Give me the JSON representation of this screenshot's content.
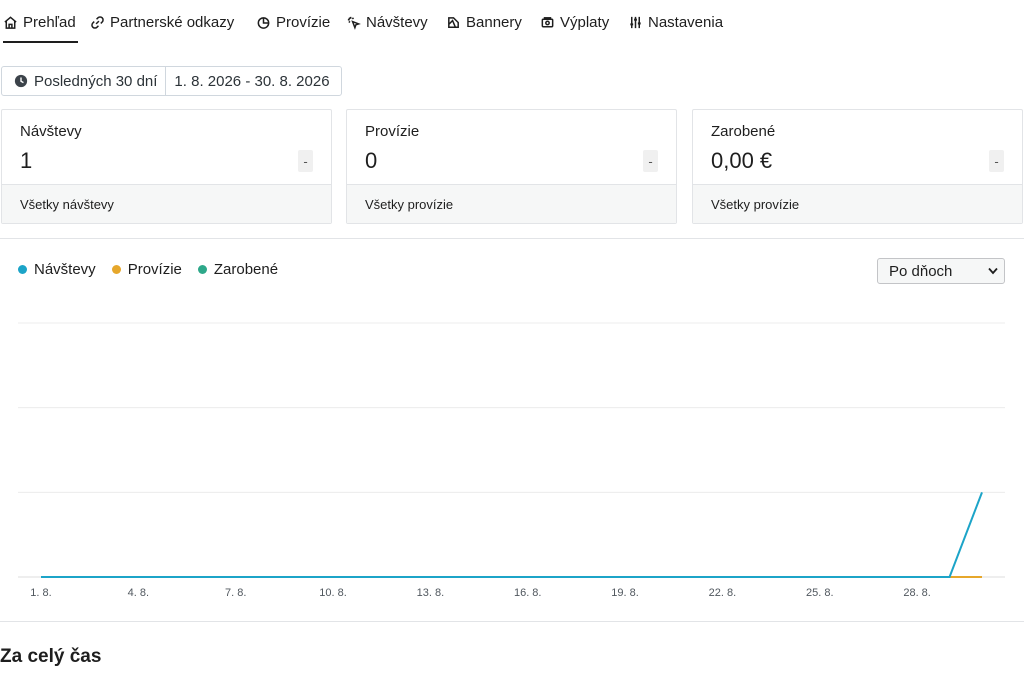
{
  "tabs": [
    {
      "label": "Prehľad",
      "icon": "home-icon",
      "active": true
    },
    {
      "label": "Partnerské odkazy",
      "icon": "link-icon"
    },
    {
      "label": "Provízie",
      "icon": "pie-chart-icon"
    },
    {
      "label": "Návštevy",
      "icon": "cursor-click-icon"
    },
    {
      "label": "Bannery",
      "icon": "banner-icon"
    },
    {
      "label": "Výplaty",
      "icon": "cash-icon"
    },
    {
      "label": "Nastavenia",
      "icon": "sliders-icon"
    }
  ],
  "daterange": {
    "preset": "Posledných 30 dní",
    "range": "1. 8. 2026 - 30. 8. 2026"
  },
  "cards": [
    {
      "title": "Návštevy",
      "value": "1",
      "delta": "-",
      "link": "Všetky návštevy"
    },
    {
      "title": "Provízie",
      "value": "0",
      "delta": "-",
      "link": "Všetky provízie"
    },
    {
      "title": "Zarobené",
      "value": "0,00 €",
      "delta": "-",
      "link": "Všetky provízie"
    }
  ],
  "legend": [
    {
      "label": "Návštevy",
      "color": "#1ca4c8"
    },
    {
      "label": "Provízie",
      "color": "#e6a72b"
    },
    {
      "label": "Zarobené",
      "color": "#2ea88a"
    }
  ],
  "interval_select": {
    "value": "Po dňoch"
  },
  "chart_data": {
    "type": "line",
    "x": [
      "1. 8.",
      "2. 8.",
      "3. 8.",
      "4. 8.",
      "5. 8.",
      "6. 8.",
      "7. 8.",
      "8. 8.",
      "9. 8.",
      "10. 8.",
      "11. 8.",
      "12. 8.",
      "13. 8.",
      "14. 8.",
      "15. 8.",
      "16. 8.",
      "17. 8.",
      "18. 8.",
      "19. 8.",
      "20. 8.",
      "21. 8.",
      "22. 8.",
      "23. 8.",
      "24. 8.",
      "25. 8.",
      "26. 8.",
      "27. 8.",
      "28. 8.",
      "29. 8.",
      "30. 8."
    ],
    "x_tick_labels": [
      "1. 8.",
      "4. 8.",
      "7. 8.",
      "10. 8.",
      "13. 8.",
      "16. 8.",
      "19. 8.",
      "22. 8.",
      "25. 8.",
      "28. 8."
    ],
    "series": [
      {
        "name": "Návštevy",
        "color": "#1ca4c8",
        "values": [
          0,
          0,
          0,
          0,
          0,
          0,
          0,
          0,
          0,
          0,
          0,
          0,
          0,
          0,
          0,
          0,
          0,
          0,
          0,
          0,
          0,
          0,
          0,
          0,
          0,
          0,
          0,
          0,
          0,
          1
        ]
      },
      {
        "name": "Provízie",
        "color": "#e6a72b",
        "values": [
          0,
          0,
          0,
          0,
          0,
          0,
          0,
          0,
          0,
          0,
          0,
          0,
          0,
          0,
          0,
          0,
          0,
          0,
          0,
          0,
          0,
          0,
          0,
          0,
          0,
          0,
          0,
          0,
          0,
          0
        ]
      },
      {
        "name": "Zarobené",
        "color": "#2ea88a",
        "values": [
          0,
          0,
          0,
          0,
          0,
          0,
          0,
          0,
          0,
          0,
          0,
          0,
          0,
          0,
          0,
          0,
          0,
          0,
          0,
          0,
          0,
          0,
          0,
          0,
          0,
          0,
          0,
          0,
          0,
          0
        ]
      }
    ],
    "ylim": [
      0,
      3
    ],
    "grid": true,
    "legend_position": "top-left"
  },
  "section_title": "Za celý čas"
}
